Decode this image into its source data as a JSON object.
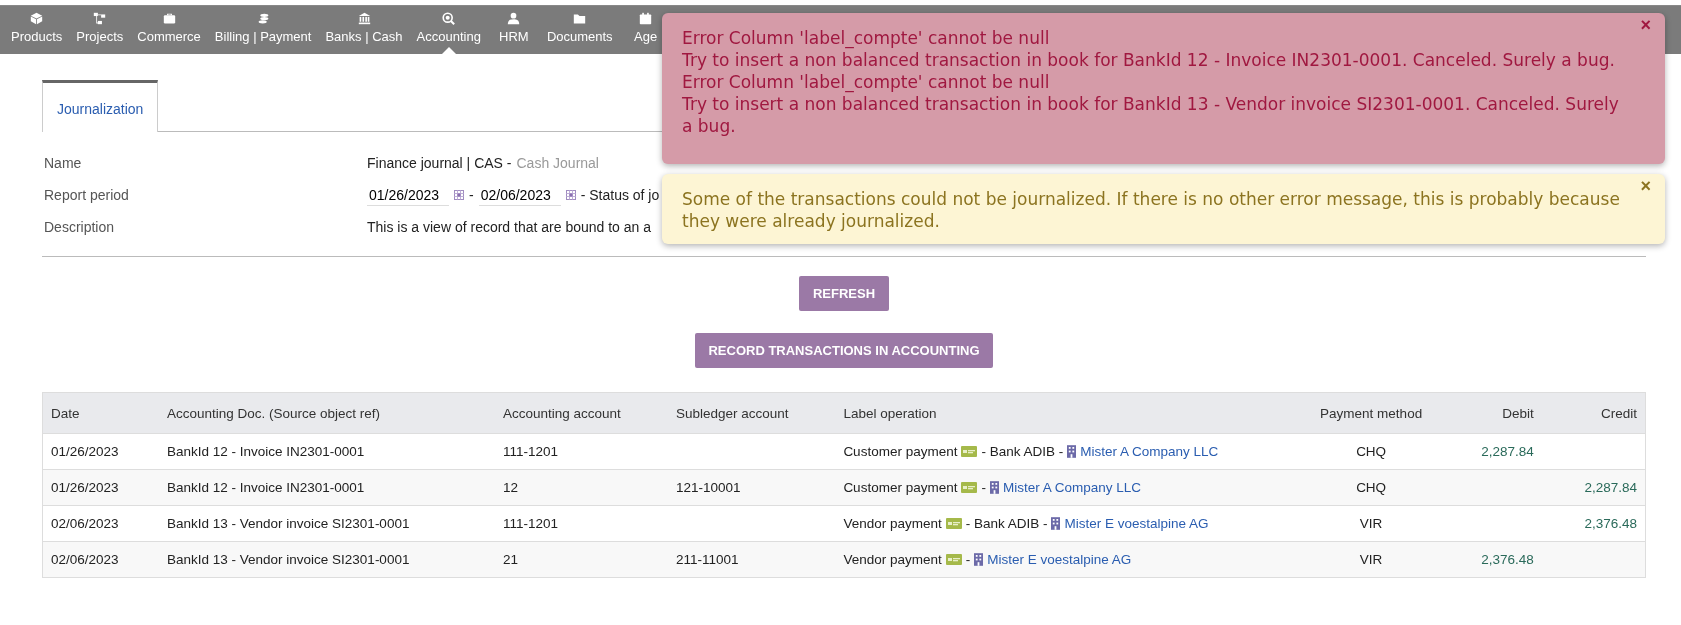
{
  "nav": [
    {
      "label": "Products",
      "selected": false
    },
    {
      "label": "Projects",
      "selected": false
    },
    {
      "label": "Commerce",
      "selected": false
    },
    {
      "label": "Billing | Payment",
      "selected": false
    },
    {
      "label": "Banks | Cash",
      "selected": false
    },
    {
      "label": "Accounting",
      "selected": true
    },
    {
      "label": "HRM",
      "selected": false
    },
    {
      "label": "Documents",
      "selected": false
    },
    {
      "label": "Age",
      "selected": false
    }
  ],
  "tabs": [
    {
      "label": "Journalization",
      "selected": true
    }
  ],
  "fields": [
    {
      "kind": "name",
      "label": "Name",
      "value": "Finance journal | CAS -",
      "note": "Cash Journal"
    },
    {
      "kind": "period",
      "label": "Report period",
      "from": "01/26/2023",
      "to": "02/06/2023",
      "sep": "-",
      "status": "- Status of jo"
    },
    {
      "kind": "text",
      "label": "Description",
      "value": "This is a view of record that are bound to an a"
    }
  ],
  "buttons": [
    "REFRESH",
    "RECORD TRANSACTIONS IN ACCOUNTING"
  ],
  "table": {
    "columns": [
      "Date",
      "Accounting Doc. (Source object ref)",
      "Accounting account",
      "Subledger account",
      "Label operation",
      "Payment method",
      "Debit",
      "Credit"
    ],
    "rows": [
      {
        "date": "01/26/2023",
        "doc": "BankId 12 - Invoice IN2301-0001",
        "account": "111-1201",
        "subledger": "",
        "label": "Customer payment",
        "sep": "- Bank ADIB -",
        "party": "Mister A Company LLC",
        "method": "CHQ",
        "debit": "2,287.84",
        "credit": ""
      },
      {
        "date": "01/26/2023",
        "doc": "BankId 12 - Invoice IN2301-0001",
        "account": "12",
        "subledger": "121-10001",
        "label": "Customer payment",
        "sep": "-",
        "party": "Mister A Company LLC",
        "method": "CHQ",
        "debit": "",
        "credit": "2,287.84"
      },
      {
        "date": "02/06/2023",
        "doc": "BankId 13 - Vendor invoice SI2301-0001",
        "account": "111-1201",
        "subledger": "",
        "label": "Vendor payment",
        "sep": "- Bank ADIB -",
        "party": "Mister E voestalpine AG",
        "method": "VIR",
        "debit": "",
        "credit": "2,376.48"
      },
      {
        "date": "02/06/2023",
        "doc": "BankId 13 - Vendor invoice SI2301-0001",
        "account": "21",
        "subledger": "211-11001",
        "label": "Vendor payment",
        "sep": "-",
        "party": "Mister E voestalpine AG",
        "method": "VIR",
        "debit": "2,376.48",
        "credit": ""
      }
    ]
  },
  "alerts": [
    {
      "kind": "error",
      "close": "×",
      "lines": [
        "Error Column 'label_compte' cannot be null",
        "Try to insert a non balanced transaction in book for BankId 12 - Invoice IN2301-0001. Canceled. Surely a bug.",
        "Error Column 'label_compte' cannot be null",
        "Try to insert a non balanced transaction in book for BankId 13 - Vendor invoice SI2301-0001. Canceled. Surely a bug."
      ]
    },
    {
      "kind": "warning",
      "close": "×",
      "lines": [
        "Some of the transactions could not be journalized. If there is no other error message, this is probably because they were already journalized."
      ]
    }
  ]
}
